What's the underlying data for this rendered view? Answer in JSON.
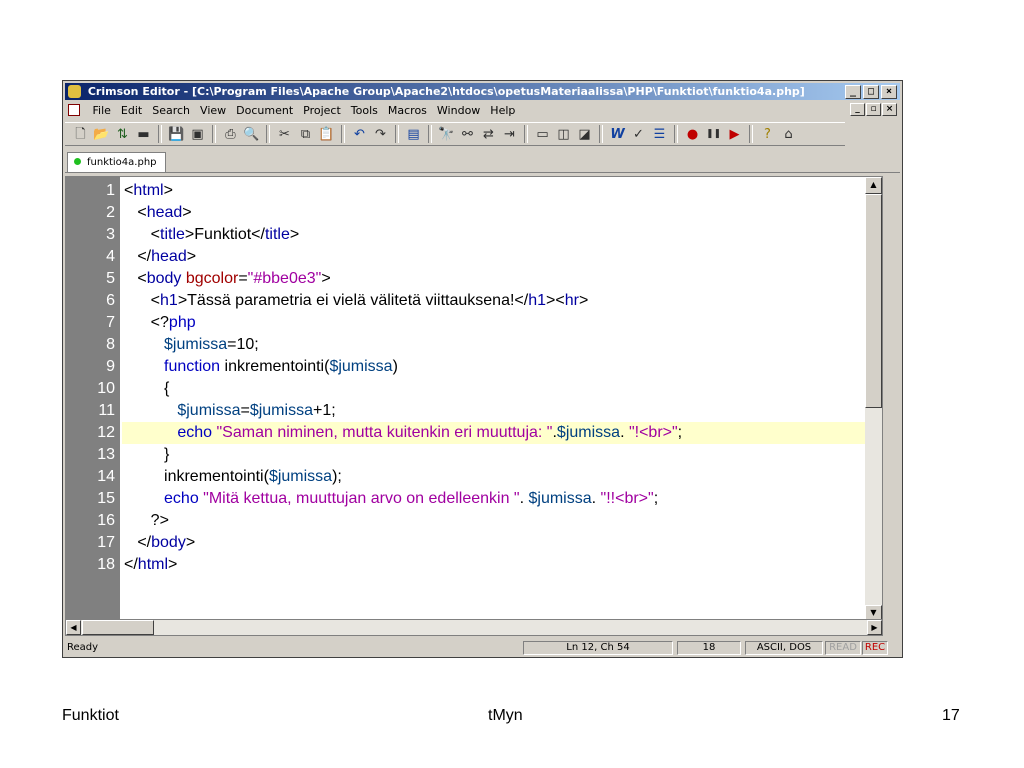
{
  "window": {
    "title": "Crimson Editor - [C:\\Program Files\\Apache Group\\Apache2\\htdocs\\opetusMateriaalissa\\PHP\\Funktiot\\funktio4a.php]",
    "controls": [
      "_",
      "□",
      "×"
    ],
    "mdi_controls": [
      "_",
      "▫",
      "×"
    ]
  },
  "menu": [
    "File",
    "Edit",
    "Search",
    "View",
    "Document",
    "Project",
    "Tools",
    "Macros",
    "Window",
    "Help"
  ],
  "toolbar_icons": [
    "new-file-icon",
    "open-file-icon",
    "open-remote-icon",
    "open-folder-icon",
    "save-icon",
    "save-all-icon",
    "print-icon",
    "print-preview-icon",
    "cut-icon",
    "copy-icon",
    "paste-icon",
    "undo-icon",
    "redo-icon",
    "column-mode-icon",
    "find-icon",
    "find-next-icon",
    "replace-icon",
    "goto-icon",
    "window-icon",
    "window-tile-icon",
    "directory-icon",
    "word-wrap-icon",
    "spell-check-icon",
    "line-numbers-icon",
    "record-macro-icon",
    "pause-macro-icon",
    "play-macro-icon",
    "help-icon",
    "home-icon"
  ],
  "tab": {
    "label": "funktio4a.php"
  },
  "editor": {
    "highlighted_line": 12,
    "line_numbers": [
      "1",
      "2",
      "3",
      "4",
      "5",
      "6",
      "7",
      "8",
      "9",
      "10",
      "11",
      "12",
      "13",
      "14",
      "15",
      "16",
      "17",
      "18"
    ],
    "lines": [
      [
        [
          "t",
          "<"
        ],
        [
          "g",
          "html"
        ],
        [
          "t",
          ">"
        ]
      ],
      [
        [
          "t",
          "   <"
        ],
        [
          "g",
          "head"
        ],
        [
          "t",
          ">"
        ]
      ],
      [
        [
          "t",
          "      <"
        ],
        [
          "g",
          "title"
        ],
        [
          "t",
          ">Funktiot</"
        ],
        [
          "g",
          "title"
        ],
        [
          "t",
          ">"
        ]
      ],
      [
        [
          "t",
          "   </"
        ],
        [
          "g",
          "head"
        ],
        [
          "t",
          ">"
        ]
      ],
      [
        [
          "t",
          "   <"
        ],
        [
          "g",
          "body"
        ],
        [
          "t",
          " "
        ],
        [
          "a",
          "bgcolor"
        ],
        [
          "t",
          "="
        ],
        [
          "s",
          "\"#bbe0e3\""
        ],
        [
          "t",
          ">"
        ]
      ],
      [
        [
          "t",
          "      <"
        ],
        [
          "g",
          "h1"
        ],
        [
          "t",
          ">Tässä parametria ei vielä välitetä viittauksena!</"
        ],
        [
          "g",
          "h1"
        ],
        [
          "t",
          "><"
        ],
        [
          "g",
          "hr"
        ],
        [
          "t",
          ">"
        ]
      ],
      [
        [
          "t",
          "      <?"
        ],
        [
          "k",
          "php"
        ]
      ],
      [
        [
          "t",
          "         "
        ],
        [
          "v",
          "$jumissa"
        ],
        [
          "t",
          "=10;"
        ]
      ],
      [
        [
          "t",
          "         "
        ],
        [
          "k",
          "function"
        ],
        [
          "t",
          " inkrementointi("
        ],
        [
          "v",
          "$jumissa"
        ],
        [
          "t",
          ")"
        ]
      ],
      [
        [
          "t",
          "         {"
        ]
      ],
      [
        [
          "t",
          "            "
        ],
        [
          "v",
          "$jumissa"
        ],
        [
          "t",
          "="
        ],
        [
          "v",
          "$jumissa"
        ],
        [
          "t",
          "+1;"
        ]
      ],
      [
        [
          "t",
          "            "
        ],
        [
          "k",
          "echo"
        ],
        [
          "t",
          " "
        ],
        [
          "s",
          "\"Saman niminen, mutta kuitenkin eri muuttuja: \""
        ],
        [
          "t",
          "."
        ],
        [
          "v",
          "$jumissa"
        ],
        [
          "t",
          ". "
        ],
        [
          "s",
          "\"!<br>\""
        ],
        [
          "t",
          ";"
        ]
      ],
      [
        [
          "t",
          "         }"
        ]
      ],
      [
        [
          "t",
          "         inkrementointi("
        ],
        [
          "v",
          "$jumissa"
        ],
        [
          "t",
          ");"
        ]
      ],
      [
        [
          "t",
          "         "
        ],
        [
          "k",
          "echo"
        ],
        [
          "t",
          " "
        ],
        [
          "s",
          "\"Mitä kettua, muuttujan arvo on edelleenkin \""
        ],
        [
          "t",
          ". "
        ],
        [
          "v",
          "$jumissa"
        ],
        [
          "t",
          ". "
        ],
        [
          "s",
          "\"!!<br>\""
        ],
        [
          "t",
          ";"
        ]
      ],
      [
        [
          "t",
          "      ?>"
        ]
      ],
      [
        [
          "t",
          "   </"
        ],
        [
          "g",
          "body"
        ],
        [
          "t",
          ">"
        ]
      ],
      [
        [
          "t",
          "</"
        ],
        [
          "g",
          "html"
        ],
        [
          "t",
          ">"
        ]
      ]
    ]
  },
  "status": {
    "ready": "Ready",
    "position": "Ln 12, Ch 54",
    "count": "18",
    "encoding": "ASCII, DOS",
    "read": "READ",
    "rec": "REC"
  },
  "footer": {
    "left": "Funktiot",
    "center": "tMyn",
    "right": "17"
  }
}
